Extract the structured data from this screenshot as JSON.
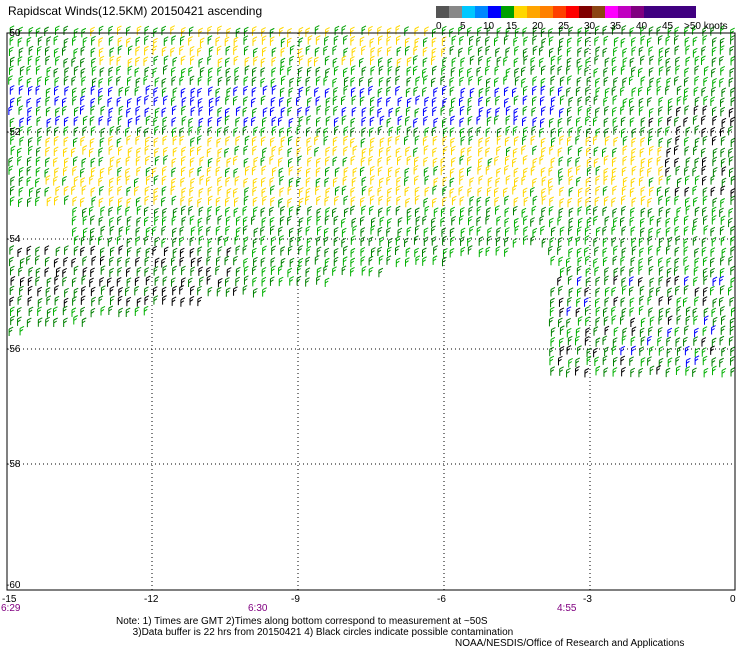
{
  "title": "Rapidscat Winds(12.5KM) 20150421 ascending",
  "scale": {
    "labels": [
      "0",
      "5",
      "10",
      "15",
      "20",
      "25",
      "30",
      "35",
      "40",
      "45",
      ">50 knots"
    ],
    "colors": [
      "#555555",
      "#888888",
      "#00c8ff",
      "#0088ff",
      "#0000ff",
      "#00a000",
      "#ffd700",
      "#ffa500",
      "#ff8000",
      "#ff4000",
      "#ff0000",
      "#800000",
      "#8b4513",
      "#ff00ff",
      "#c000c0",
      "#800080",
      "#400080"
    ]
  },
  "map": {
    "lat_labels": [
      "-50",
      "-52",
      "-54",
      "-56",
      "-58",
      "-60"
    ],
    "lon_labels": [
      "-15",
      "-12",
      "-9",
      "-6",
      "-3",
      "0"
    ],
    "time_labels": [
      "6:29",
      "6:30",
      "4:55"
    ],
    "grid": "dotted"
  },
  "notes": {
    "line1": "Note: 1) Times are GMT 2)Times along bottom correspond to measurement at ~50S",
    "line2": "3)Data buffer is 22 hrs from 20150421 4) Black circles indicate possible contamination"
  },
  "credit": "NOAA/NESDIS/Office of Research and Applications"
}
